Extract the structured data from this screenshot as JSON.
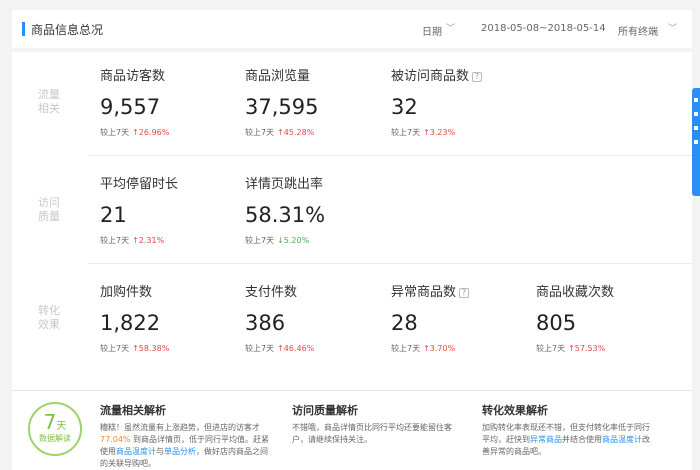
{
  "header": {
    "title": "商品信息总况",
    "date_label": "日期",
    "date_range": "2018-05-08~2018-05-14",
    "terminal": "所有终端"
  },
  "sections": {
    "traffic": "流量相关",
    "visit": "访问质量",
    "conversion": "转化效果"
  },
  "compare_label": "较上7天",
  "metrics": {
    "visitors": {
      "name": "商品访客数",
      "value": "9,557",
      "change": "26.96%",
      "direction": "up"
    },
    "pageviews": {
      "name": "商品浏览量",
      "value": "37,595",
      "change": "45.28%",
      "direction": "up"
    },
    "visited_items": {
      "name": "被访问商品数",
      "value": "32",
      "change": "3.23%",
      "direction": "up"
    },
    "avg_stay": {
      "name": "平均停留时长",
      "value": "21",
      "change": "2.31%",
      "direction": "up"
    },
    "bounce_rate": {
      "name": "详情页跳出率",
      "value": "58.31%",
      "change": "5.20%",
      "direction": "down"
    },
    "cart_items": {
      "name": "加购件数",
      "value": "1,822",
      "change": "58.38%",
      "direction": "up"
    },
    "paid_items": {
      "name": "支付件数",
      "value": "386",
      "change": "46.46%",
      "direction": "up"
    },
    "abnormal_items": {
      "name": "异常商品数",
      "value": "28",
      "change": "3.70%",
      "direction": "up"
    },
    "favorites": {
      "name": "商品收藏次数",
      "value": "805",
      "change": "57.53%",
      "direction": "up"
    }
  },
  "analysis": {
    "badge_num": "7",
    "badge_unit": "天",
    "badge_text": "数据解读",
    "traffic": {
      "title": "流量相关解析",
      "text_a": "糟糕！虽然流量有上涨趋势，但进店的访客才 ",
      "highlight": "77.04%",
      "text_b": " 到商品详情页，低于同行平均值。赶紧使用",
      "link_a": "商品温度计",
      "text_c": "与",
      "link_b": "单品分析",
      "text_d": "，做好店内商品之间的关联导购吧。"
    },
    "visit": {
      "title": "访问质量解析",
      "text": "不错哦，商品详情页比同行平均还要能留住客户，请继续保持关注。"
    },
    "conversion": {
      "title": "转化效果解析",
      "text_a": "加购转化率表现还不错，但支付转化率低于同行平均，赶快到",
      "link_a": "异常商品",
      "text_b": "并结合使用",
      "link_b": "商品温度计",
      "text_c": "改善异常的商品吧。"
    }
  },
  "colors": {
    "accent": "#2a8ef5",
    "up": "#e94848",
    "down": "#4caf50",
    "badge": "#7dc242",
    "highlight": "#f08c1e"
  },
  "icons": {
    "up": "↑",
    "down": "↓",
    "help": "?",
    "caret": "﹀"
  }
}
